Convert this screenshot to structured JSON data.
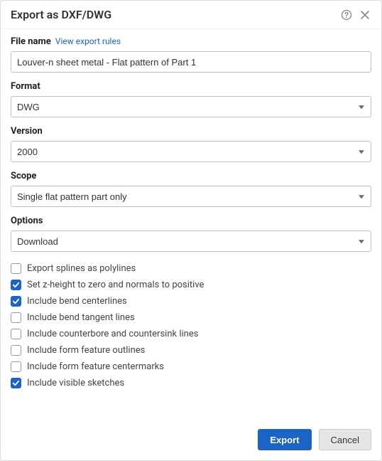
{
  "dialog": {
    "title": "Export as DXF/DWG"
  },
  "fields": {
    "filename": {
      "label": "File name",
      "link": "View export rules",
      "value": "Louver-n sheet metal - Flat pattern of Part 1"
    },
    "format": {
      "label": "Format",
      "value": "DWG"
    },
    "version": {
      "label": "Version",
      "value": "2000"
    },
    "scope": {
      "label": "Scope",
      "value": "Single flat pattern part only"
    },
    "options": {
      "label": "Options",
      "value": "Download"
    }
  },
  "checkboxes": [
    {
      "label": "Export splines as polylines",
      "checked": false
    },
    {
      "label": "Set z-height to zero and normals to positive",
      "checked": true
    },
    {
      "label": "Include bend centerlines",
      "checked": true
    },
    {
      "label": "Include bend tangent lines",
      "checked": false
    },
    {
      "label": "Include counterbore and countersink lines",
      "checked": false
    },
    {
      "label": "Include form feature outlines",
      "checked": false
    },
    {
      "label": "Include form feature centermarks",
      "checked": false
    },
    {
      "label": "Include visible sketches",
      "checked": true
    }
  ],
  "footer": {
    "primary": "Export",
    "secondary": "Cancel"
  }
}
